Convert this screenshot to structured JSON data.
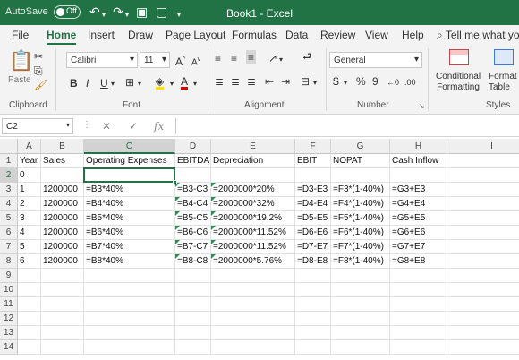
{
  "titlebar": {
    "autosave_label": "AutoSave",
    "autosave_state": "Off",
    "title": "Book1  -  Excel"
  },
  "tabs": [
    "File",
    "Home",
    "Insert",
    "Draw",
    "Page Layout",
    "Formulas",
    "Data",
    "Review",
    "View",
    "Help"
  ],
  "active_tab": "Home",
  "tell_me": "Tell me what you",
  "ribbon": {
    "paste_label": "Paste",
    "font_name": "Calibri",
    "font_size": "11",
    "number_format": "General",
    "conditional_formatting": "Conditional\nFormatting",
    "format_as_table": "Format as\nTable",
    "groups": {
      "clipboard": "Clipboard",
      "font": "Font",
      "alignment": "Alignment",
      "number": "Number",
      "styles": "Styles"
    }
  },
  "formula_bar": {
    "name_box": "C2",
    "fx": "fx",
    "value": ""
  },
  "sheet": {
    "columns": [
      "A",
      "B",
      "C",
      "D",
      "E",
      "F",
      "G",
      "H",
      "I"
    ],
    "selected_column": "C",
    "selected_row": 2,
    "rows": [
      "1",
      "2",
      "3",
      "4",
      "5",
      "6",
      "7",
      "8",
      "9",
      "10",
      "11",
      "12",
      "13",
      "14"
    ],
    "headers": [
      "Year",
      "Sales",
      "Operating Expenses",
      "EBITDA",
      "Depreciation",
      "EBIT",
      "NOPAT",
      "Cash Inflow"
    ],
    "row2": [
      "0"
    ],
    "data": [
      [
        "1",
        "1200000",
        "=B3*40%",
        "=B3-C3",
        "=2000000*20%",
        "=D3-E3",
        "=F3*(1-40%)",
        "=G3+E3"
      ],
      [
        "2",
        "1200000",
        "=B4*40%",
        "=B4-C4",
        "=2000000*32%",
        "=D4-E4",
        "=F4*(1-40%)",
        "=G4+E4"
      ],
      [
        "3",
        "1200000",
        "=B5*40%",
        "=B5-C5",
        "=2000000*19.2%",
        "=D5-E5",
        "=F5*(1-40%)",
        "=G5+E5"
      ],
      [
        "4",
        "1200000",
        "=B6*40%",
        "=B6-C6",
        "=2000000*11.52%",
        "=D6-E6",
        "=F6*(1-40%)",
        "=G6+E6"
      ],
      [
        "5",
        "1200000",
        "=B7*40%",
        "=B7-C7",
        "=2000000*11.52%",
        "=D7-E7",
        "=F7*(1-40%)",
        "=G7+E7"
      ],
      [
        "6",
        "1200000",
        "=B8*40%",
        "=B8-C8",
        "=2000000*5.76%",
        "=D8-E8",
        "=F8*(1-40%)",
        "=G8+E8"
      ]
    ]
  },
  "colors": {
    "accent": "#217346",
    "ribbon_bg": "#f3f3f3",
    "error_marker": "#2e8b57"
  }
}
